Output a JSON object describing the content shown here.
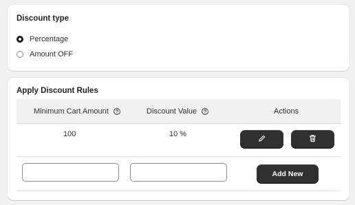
{
  "discount_type": {
    "title": "Discount type",
    "options": [
      {
        "label": "Percentage",
        "selected": true
      },
      {
        "label": "Amount OFF",
        "selected": false
      }
    ]
  },
  "rules": {
    "title": "Apply Discount Rules",
    "columns": {
      "min_cart": "Minimum Cart Amount",
      "discount_value": "Discount Value",
      "actions": "Actions"
    },
    "rows": [
      {
        "min_cart": "100",
        "discount_value": "10 %"
      }
    ],
    "new_row": {
      "min_cart_value": "",
      "discount_value_value": "",
      "add_label": "Add New"
    }
  },
  "colors": {
    "page_bg": "#f1f1f1",
    "card_bg": "#ffffff",
    "button_dark": "#303030",
    "header_bg": "#f1f1f1"
  },
  "icons": {
    "help": "question-circle-icon",
    "edit": "pencil-icon",
    "delete": "trash-icon"
  }
}
